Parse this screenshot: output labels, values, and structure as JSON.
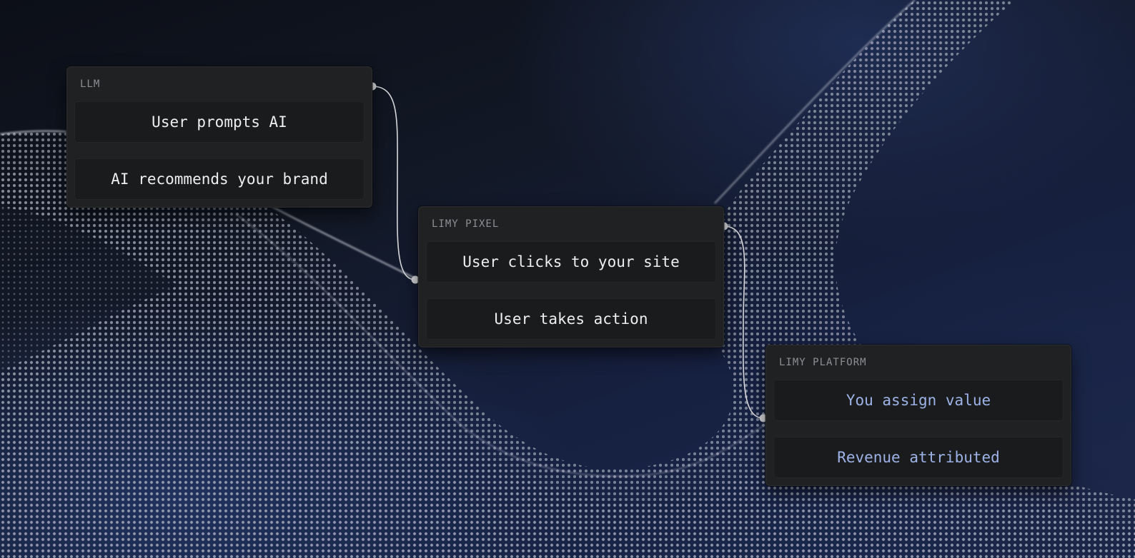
{
  "colors": {
    "accent_text": "#9db3e8",
    "node_background": "#202122",
    "row_background": "#1a1b1c",
    "connector": "#d6d7da"
  },
  "nodes": [
    {
      "label": "LLM",
      "rows": [
        "User prompts AI",
        "AI recommends your brand"
      ]
    },
    {
      "label": "LIMY PIXEL",
      "rows": [
        "User clicks to your site",
        "User takes action"
      ]
    },
    {
      "label": "LIMY PLATFORM",
      "rows": [
        "You assign value",
        "Revenue attributed"
      ]
    }
  ]
}
